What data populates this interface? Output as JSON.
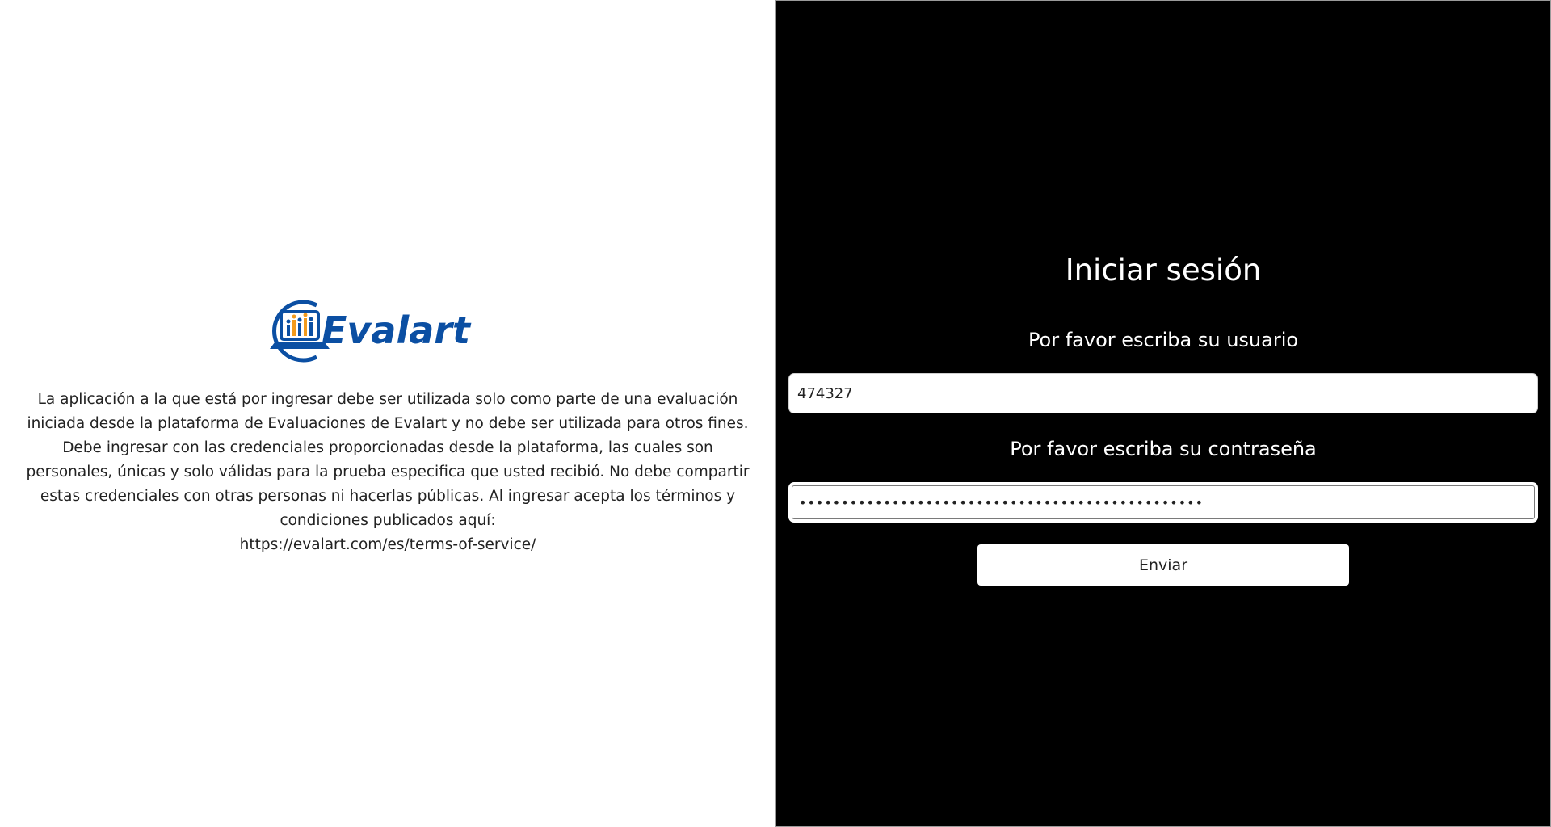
{
  "left_panel": {
    "logo_text": "Evalart",
    "disclaimer": "La aplicación a la que está por ingresar debe ser utilizada solo como parte de una evaluación iniciada desde la plataforma de Evaluaciones de Evalart y no debe ser utilizada para otros fines. Debe ingresar con las credenciales proporcionadas desde la plataforma, las cuales son personales, únicas y solo válidas para la prueba especifica que usted recibió. No debe compartir estas credenciales con otras personas ni hacerlas públicas. Al ingresar acepta los términos y condiciones publicados aquí:",
    "terms_link": "https://evalart.com/es/terms-of-service/"
  },
  "login": {
    "title": "Iniciar sesión",
    "username_label": "Por favor escriba su usuario",
    "username_value": "474327",
    "password_label": "Por favor escriba su contraseña",
    "password_value": "••••••••••••••••••••••••••••••••••••••••••••••••",
    "submit_label": "Enviar"
  },
  "colors": {
    "brand_blue": "#0b4fa3",
    "accent_orange": "#f29a1c",
    "panel_dark": "#000000"
  }
}
